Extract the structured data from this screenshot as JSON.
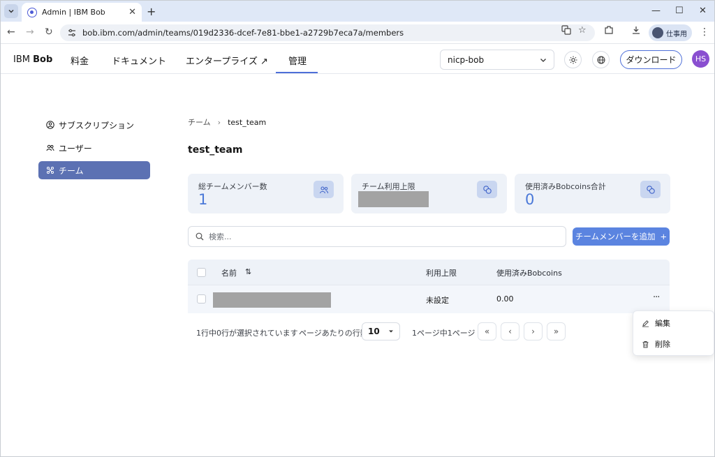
{
  "browser": {
    "tab_title": "Admin | IBM Bob",
    "url": "bob.ibm.com/admin/teams/019d2336-dcef-7e81-bbe1-a2729b7eca7a/members",
    "profile_label": "仕事用"
  },
  "header": {
    "brand_prefix": "IBM ",
    "brand_name": "Bob",
    "nav": [
      {
        "label": "料金"
      },
      {
        "label": "ドキュメント"
      },
      {
        "label": "エンタープライズ ↗"
      },
      {
        "label": "管理"
      }
    ],
    "active_nav": "管理",
    "org_select_value": "nicp-bob",
    "download_label": "ダウンロード",
    "avatar_initials": "HS",
    "accent_color": "#4e6fd8"
  },
  "sidebar": {
    "items": [
      {
        "label": "サブスクリプション",
        "icon": "user-circle-icon"
      },
      {
        "label": "ユーザー",
        "icon": "users-icon"
      },
      {
        "label": "チーム",
        "icon": "team-icon",
        "active": true
      }
    ]
  },
  "breadcrumb": {
    "parent": "チーム",
    "separator": "›",
    "current": "test_team"
  },
  "page": {
    "title": "test_team"
  },
  "stats": [
    {
      "label": "総チームメンバー数",
      "value": "1",
      "icon": "users-icon"
    },
    {
      "label": "チーム利用上限",
      "value": "",
      "redacted": true,
      "icon": "coins-icon"
    },
    {
      "label": "使用済みBobcoins合計",
      "value": "0",
      "icon": "coins-icon"
    }
  ],
  "search": {
    "placeholder": "検索..."
  },
  "add_member_button": {
    "label": "チームメンバーを追加",
    "suffix": "+"
  },
  "table": {
    "columns": [
      {
        "label": "名前",
        "sort_icon": "⇅"
      },
      {
        "label": "利用上限"
      },
      {
        "label": "使用済みBobcoins"
      }
    ],
    "rows": [
      {
        "name": "",
        "name_redacted": true,
        "limit": "未設定",
        "used": "0.00"
      }
    ],
    "row_menu_glyph": "···"
  },
  "pagination": {
    "selection_text": "1行中0行が選択されています",
    "rows_per_page_label": "ページあたりの行数",
    "rows_per_page_value": "10",
    "page_info": "1ページ中1ページ",
    "first": "«",
    "prev": "‹",
    "next": "›",
    "last": "»"
  },
  "context_menu": {
    "items": [
      {
        "label": "編集",
        "icon": "pencil-icon"
      },
      {
        "label": "削除",
        "icon": "trash-icon"
      }
    ]
  }
}
